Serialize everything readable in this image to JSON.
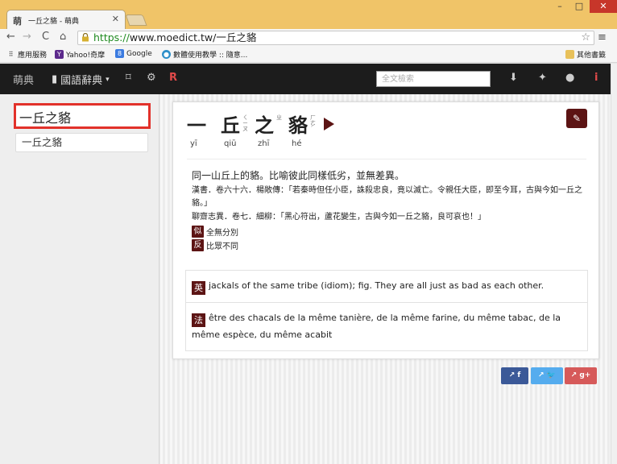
{
  "browser": {
    "tab_favicon": "萌",
    "tab_title": "一丘之貉 - 萌典",
    "url_scheme": "https://",
    "url_rest": "www.moedict.tw/一丘之貉",
    "bookmarks": [
      {
        "icon": "apps-icon",
        "label": "應用服務"
      },
      {
        "icon": "yahoo-icon",
        "label": "Yahoo!奇摩"
      },
      {
        "icon": "google-icon",
        "label": "Google"
      },
      {
        "icon": "globe-icon",
        "label": "數體使用教學 :: 隨意..."
      }
    ],
    "other_bookmarks": "其他書籤"
  },
  "nav": {
    "logo": "萌典",
    "dict_label": "國語辭典",
    "search_placeholder": "全文檢索"
  },
  "sidebar": {
    "query": "一丘之貉",
    "results": [
      "一丘之貉"
    ]
  },
  "entry": {
    "chars": [
      {
        "c": "一",
        "p": "yī",
        "z": ""
      },
      {
        "c": "丘",
        "p": "qiū",
        "z": "ㄑㄧㄡ"
      },
      {
        "c": "之",
        "p": "zhī",
        "z": "ㄓ"
      },
      {
        "c": "貉",
        "p": "hé",
        "z": "ㄏㄜˊ"
      }
    ],
    "definition": "同一山丘上的貉。比喻彼此同樣低劣，並無差異。",
    "examples": [
      "漢書．卷六十六．楊敞傳：「若秦時但任小臣，誅殺忠良，竟以滅亡。令親任大臣，即至今耳，古與今如一丘之貉。」",
      "聊齋志異．卷七．細柳：「黑心符出，蘆花變生，古與今如一丘之貉，良可哀也！」"
    ],
    "synonym_tag": "似",
    "synonym": "全無分別",
    "antonym_tag": "反",
    "antonym": "比眾不同",
    "translations": [
      {
        "tag": "英",
        "text": "jackals of the same tribe (idiom); fig. They are all just as bad as each other."
      },
      {
        "tag": "法",
        "text": "être des chacals de la même tanière, de la même farine, du même tabac, de la même espèce, du même acabit"
      }
    ]
  },
  "share": {
    "fb": "f",
    "tw": "🐦",
    "gp": "g+"
  }
}
